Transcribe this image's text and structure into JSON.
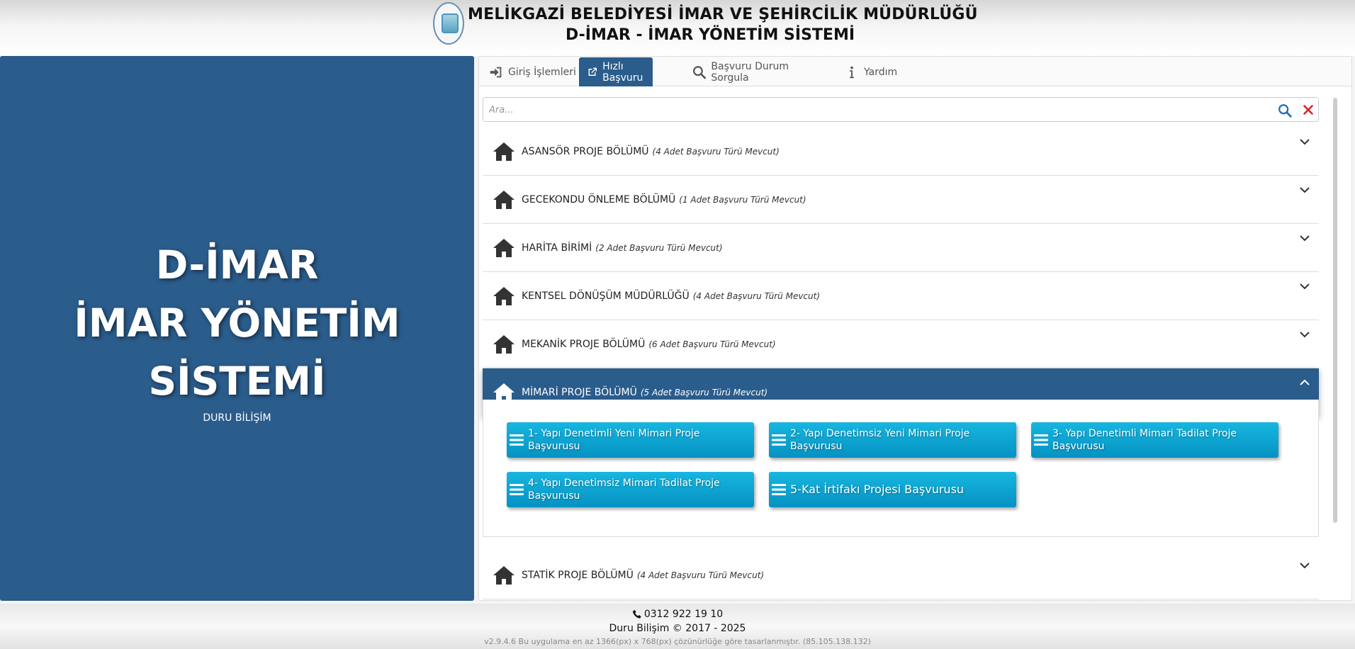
{
  "header": {
    "line1": "MELİKGAZİ BELEDİYESİ İMAR VE ŞEHİRCİLİK MÜDÜRLÜĞÜ",
    "line2": "D-İMAR - İMAR YÖNETİM SİSTEMİ",
    "logo_icon": "municipality-logo"
  },
  "left_panel": {
    "title": "D-İMAR\nİMAR YÖNETİM\nSİSTEMİ",
    "subtitle": "DURU BİLİŞİM",
    "background_color": "#2a5c8c"
  },
  "tabs": [
    {
      "label": "Giriş İşlemleri",
      "icon": "sign-in-icon",
      "active": false
    },
    {
      "label": "Hızlı Başvuru",
      "icon": "external-link-icon",
      "active": true
    },
    {
      "label": "Başvuru Durum Sorgula",
      "icon": "search-icon",
      "active": false
    },
    {
      "label": "Yardım",
      "icon": "info-icon",
      "active": false
    }
  ],
  "search": {
    "placeholder": "Ara...",
    "value": ""
  },
  "accordion": [
    {
      "title": "ASANSÖR PROJE BÖLÜMÜ",
      "count": "(4 Adet Başvuru Türü Mevcut)",
      "open": false
    },
    {
      "title": "GECEKONDU ÖNLEME BÖLÜMÜ",
      "count": "(1 Adet Başvuru Türü Mevcut)",
      "open": false
    },
    {
      "title": "HARİTA BİRİMİ",
      "count": "(2 Adet Başvuru Türü Mevcut)",
      "open": false
    },
    {
      "title": "KENTSEL DÖNÜŞÜM MÜDÜRLÜĞÜ",
      "count": "(4 Adet Başvuru Türü Mevcut)",
      "open": false
    },
    {
      "title": "MEKANİK PROJE BÖLÜMÜ",
      "count": "(6 Adet Başvuru Türü Mevcut)",
      "open": false
    },
    {
      "title": "MİMARİ PROJE BÖLÜMÜ",
      "count": "(5 Adet Başvuru Türü Mevcut)",
      "open": true
    },
    {
      "title": "STATİK PROJE BÖLÜMÜ",
      "count": "(4 Adet Başvuru Türü Mevcut)",
      "open": false
    }
  ],
  "open_section_items": [
    "1- Yapı Denetimli Yeni Mimari Proje Başvurusu",
    "2- Yapı Denetimsiz Yeni Mimari Proje Başvurusu",
    "3- Yapı Denetimli Mimari Tadilat Proje Başvurusu",
    "4- Yapı Denetimsiz Mimari Tadilat Proje Başvurusu",
    "5-Kat İrtifakı Projesi Başvurusu"
  ],
  "footer": {
    "phone": "0312 922 19 10",
    "copyright": "Duru Bilişim © 2017 - 2025",
    "version": "v2.9.4.6 Bu uygulama en az 1366(px) x 768(px) çözünürlüğe göre tasarlanmıştır. (85.105.138.132)"
  },
  "colors": {
    "primary": "#2a5c8c",
    "button": "#0ea5d4",
    "clear": "#e02020",
    "search_icon": "#1f6fb2"
  }
}
